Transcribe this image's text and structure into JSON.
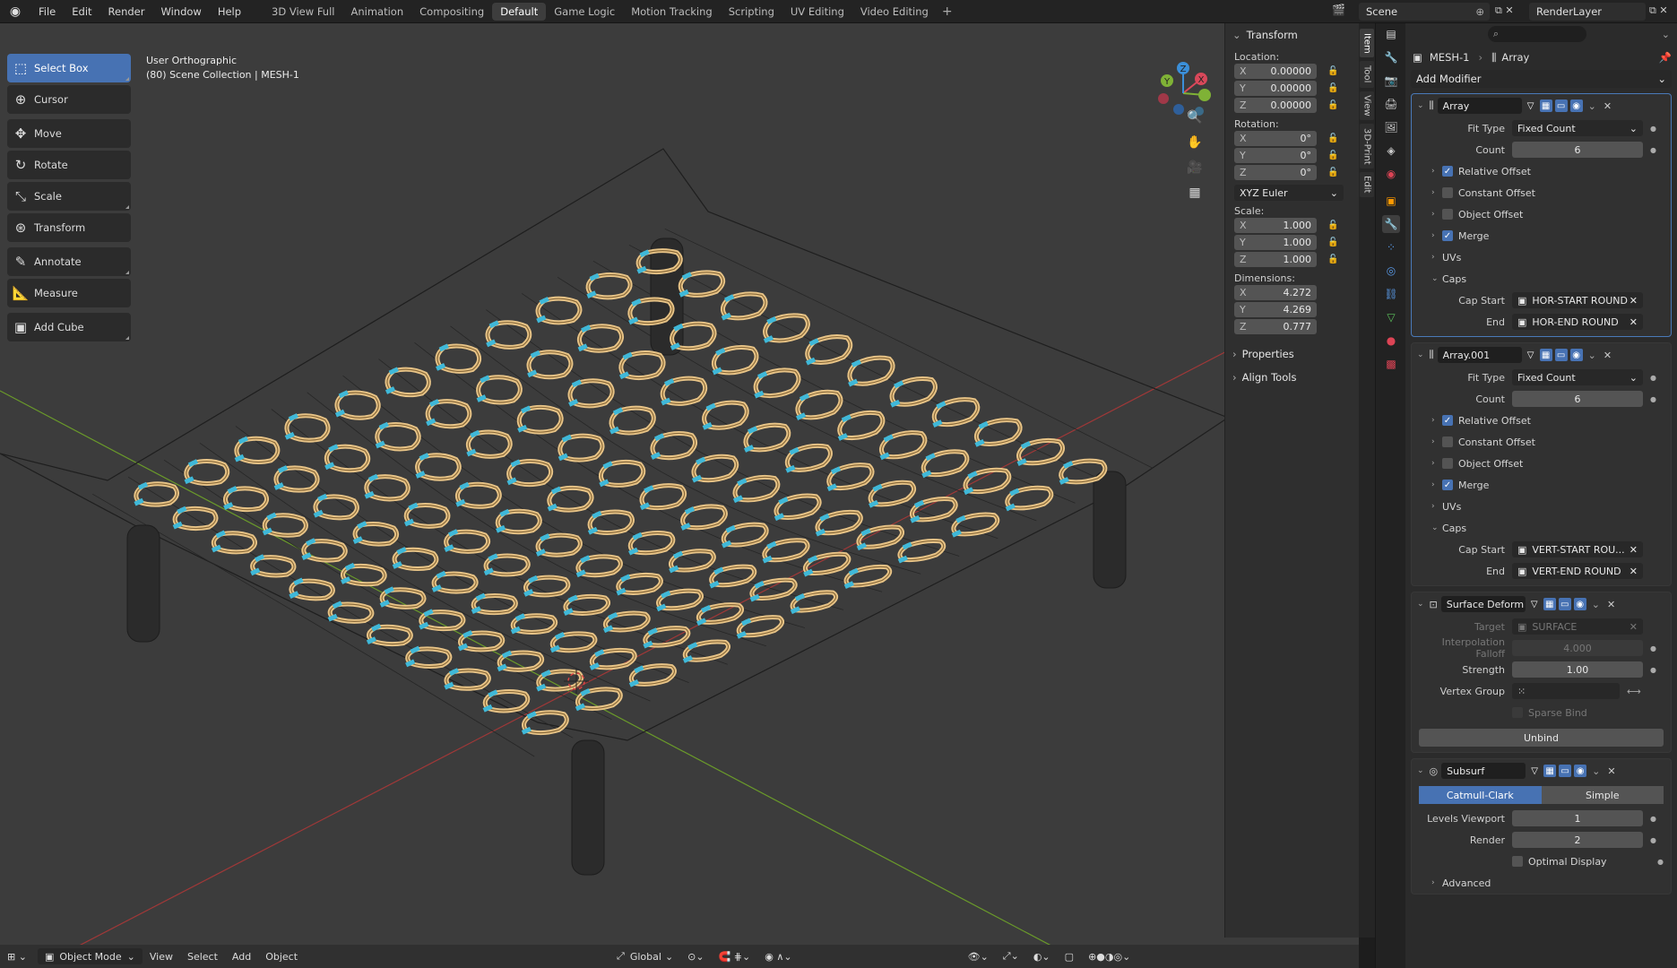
{
  "topbar": {
    "menus": [
      "File",
      "Edit",
      "Render",
      "Window",
      "Help"
    ],
    "workspaces": [
      "3D View Full",
      "Animation",
      "Compositing",
      "Default",
      "Game Logic",
      "Motion Tracking",
      "Scripting",
      "UV Editing",
      "Video Editing"
    ],
    "active_workspace": "Default",
    "add_workspace": "+",
    "scene": "Scene",
    "view_layer": "RenderLayer"
  },
  "toolbar": {
    "tools": [
      {
        "label": "Select Box",
        "icon": "select-box-icon",
        "active": true
      },
      {
        "label": "Cursor",
        "icon": "cursor-icon"
      },
      {
        "label": "Move",
        "icon": "move-icon"
      },
      {
        "label": "Rotate",
        "icon": "rotate-icon"
      },
      {
        "label": "Scale",
        "icon": "scale-icon"
      },
      {
        "label": "Transform",
        "icon": "transform-icon"
      },
      {
        "label": "Annotate",
        "icon": "annotate-icon"
      },
      {
        "label": "Measure",
        "icon": "measure-icon"
      },
      {
        "label": "Add Cube",
        "icon": "add-cube-icon"
      }
    ]
  },
  "viewport": {
    "view_name": "User Orthographic",
    "collection": "(80) Scene Collection | MESH-1",
    "gizmo": {
      "x": "X",
      "y": "Y",
      "z": "Z"
    }
  },
  "npanel": {
    "transform_title": "Transform",
    "location_label": "Location:",
    "location": [
      {
        "axis": "X",
        "value": "0.00000"
      },
      {
        "axis": "Y",
        "value": "0.00000"
      },
      {
        "axis": "Z",
        "value": "0.00000"
      }
    ],
    "rotation_label": "Rotation:",
    "rotation": [
      {
        "axis": "X",
        "value": "0°"
      },
      {
        "axis": "Y",
        "value": "0°"
      },
      {
        "axis": "Z",
        "value": "0°"
      }
    ],
    "rotation_mode": "XYZ Euler",
    "scale_label": "Scale:",
    "scale": [
      {
        "axis": "X",
        "value": "1.000"
      },
      {
        "axis": "Y",
        "value": "1.000"
      },
      {
        "axis": "Z",
        "value": "1.000"
      }
    ],
    "dimensions_label": "Dimensions:",
    "dimensions": [
      {
        "axis": "X",
        "value": "4.272"
      },
      {
        "axis": "Y",
        "value": "4.269"
      },
      {
        "axis": "Z",
        "value": "0.777"
      }
    ],
    "properties": "Properties",
    "align_tools": "Align Tools",
    "tabs": [
      "Item",
      "Tool",
      "View",
      "3D-Print",
      "Edit"
    ]
  },
  "properties": {
    "object": "MESH-1",
    "modifier_crumb": "Array",
    "add_modifier": "Add Modifier",
    "array1": {
      "name": "Array",
      "fit_type_label": "Fit Type",
      "fit_type": "Fixed Count",
      "count_label": "Count",
      "count": "6",
      "relative_offset": "Relative Offset",
      "constant_offset": "Constant Offset",
      "object_offset": "Object Offset",
      "merge": "Merge",
      "uvs": "UVs",
      "caps": "Caps",
      "cap_start_label": "Cap Start",
      "cap_start": "HOR-START ROUND",
      "end_label": "End",
      "end": "HOR-END ROUND"
    },
    "array2": {
      "name": "Array.001",
      "fit_type_label": "Fit Type",
      "fit_type": "Fixed Count",
      "count_label": "Count",
      "count": "6",
      "relative_offset": "Relative Offset",
      "constant_offset": "Constant Offset",
      "object_offset": "Object Offset",
      "merge": "Merge",
      "uvs": "UVs",
      "caps": "Caps",
      "cap_start_label": "Cap Start",
      "cap_start": "VERT-START ROU...",
      "end_label": "End",
      "end": "VERT-END ROUND"
    },
    "surface_deform": {
      "name": "Surface Deform",
      "target_label": "Target",
      "target": "SURFACE",
      "falloff_label": "Interpolation Falloff",
      "falloff": "4.000",
      "strength_label": "Strength",
      "strength": "1.00",
      "vgroup_label": "Vertex Group",
      "sparse_bind": "Sparse Bind",
      "unbind": "Unbind"
    },
    "subsurf": {
      "name": "Subsurf",
      "catmull": "Catmull-Clark",
      "simple": "Simple",
      "levels_label": "Levels Viewport",
      "levels": "1",
      "render_label": "Render",
      "render": "2",
      "optimal_display": "Optimal Display",
      "advanced": "Advanced"
    }
  },
  "bottombar": {
    "mode": "Object Mode",
    "view": "View",
    "select": "Select",
    "add": "Add",
    "object": "Object",
    "orientation": "Global"
  },
  "colors": {
    "accent": "#4772b3",
    "rope": "#e8c487",
    "clip": "#3fb8d8",
    "grid_x": "#a03838",
    "grid_y": "#6a9a2a"
  }
}
